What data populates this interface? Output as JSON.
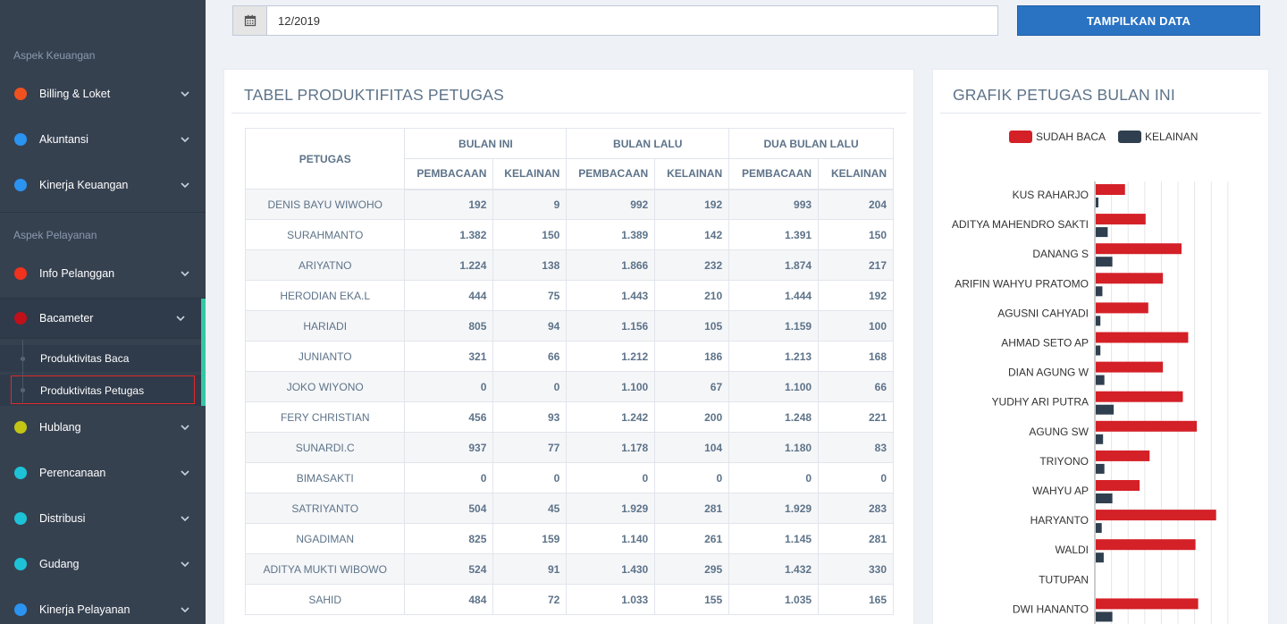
{
  "sidebar": {
    "section1": "Aspek Keuangan",
    "section2": "Aspek Pelayanan",
    "items": [
      {
        "label": "Billing & Loket",
        "color": "#f0521f"
      },
      {
        "label": "Akuntansi",
        "color": "#2b93f0"
      },
      {
        "label": "Kinerja Keuangan",
        "color": "#2b93f0"
      },
      {
        "label": "Info Pelanggan",
        "color": "#f0321f"
      },
      {
        "label": "Bacameter",
        "color": "#c0101a"
      },
      {
        "label": "Hublang",
        "color": "#c2c514"
      },
      {
        "label": "Perencanaan",
        "color": "#1ec2d6"
      },
      {
        "label": "Distribusi",
        "color": "#1ec2d6"
      },
      {
        "label": "Gudang",
        "color": "#1ec2d6"
      },
      {
        "label": "Kinerja Pelayanan",
        "color": "#2b93f0"
      }
    ],
    "subitems": [
      {
        "label": "Produktivitas Baca"
      },
      {
        "label": "Produktivitas Petugas"
      }
    ]
  },
  "filter": {
    "date_value": "12/2019",
    "button_label": "TAMPILKAN DATA"
  },
  "table_panel": {
    "title": "TABEL PRODUKTIFITAS PETUGAS",
    "col_petugas": "PETUGAS",
    "groups": [
      "BULAN INI",
      "BULAN LALU",
      "DUA BULAN LALU"
    ],
    "sub_headers": [
      "PEMBACAAN",
      "KELAINAN",
      "PEMBACAAN",
      "KELAINAN",
      "PEMBACAAN",
      "KELAINAN"
    ],
    "rows": [
      [
        "DENIS BAYU WIWOHO",
        "192",
        "9",
        "992",
        "192",
        "993",
        "204"
      ],
      [
        "SURAHMANTO",
        "1.382",
        "150",
        "1.389",
        "142",
        "1.391",
        "150"
      ],
      [
        "ARIYATNO",
        "1.224",
        "138",
        "1.866",
        "232",
        "1.874",
        "217"
      ],
      [
        "HERODIAN EKA.L",
        "444",
        "75",
        "1.443",
        "210",
        "1.444",
        "192"
      ],
      [
        "HARIADI",
        "805",
        "94",
        "1.156",
        "105",
        "1.159",
        "100"
      ],
      [
        "JUNIANTO",
        "321",
        "66",
        "1.212",
        "186",
        "1.213",
        "168"
      ],
      [
        "JOKO WIYONO",
        "0",
        "0",
        "1.100",
        "67",
        "1.100",
        "66"
      ],
      [
        "FERY CHRISTIAN",
        "456",
        "93",
        "1.242",
        "200",
        "1.248",
        "221"
      ],
      [
        "SUNARDI.C",
        "937",
        "77",
        "1.178",
        "104",
        "1.180",
        "83"
      ],
      [
        "BIMASAKTI",
        "0",
        "0",
        "0",
        "0",
        "0",
        "0"
      ],
      [
        "SATRIYANTO",
        "504",
        "45",
        "1.929",
        "281",
        "1.929",
        "283"
      ],
      [
        "NGADIMAN",
        "825",
        "159",
        "1.140",
        "261",
        "1.145",
        "281"
      ],
      [
        "ADITYA MUKTI WIBOWO",
        "524",
        "91",
        "1.430",
        "295",
        "1.432",
        "330"
      ],
      [
        "SAHID",
        "484",
        "72",
        "1.033",
        "155",
        "1.035",
        "165"
      ]
    ]
  },
  "chart_panel": {
    "title": "GRAFIK PETUGAS BULAN INI"
  },
  "chart_data": {
    "type": "bar",
    "orientation": "horizontal",
    "legend_position": "top",
    "categories": [
      "KUS RAHARJO",
      "ADITYA MAHENDRO SAKTI",
      "DANANG S",
      "ARIFIN WAHYU PRATOMO",
      "AGUSNI CAHYADI",
      "AHMAD SETO AP",
      "DIAN AGUNG W",
      "YUDHY ARI PUTRA",
      "AGUNG SW",
      "TRIYONO",
      "WAHYU AP",
      "HARYANTO",
      "WALDI",
      "TUTUPAN",
      "DWI HANANTO"
    ],
    "series": [
      {
        "name": "SUDAH BACA",
        "color": "#d42027",
        "values": [
          440,
          750,
          1290,
          1010,
          790,
          1390,
          1010,
          1310,
          1520,
          810,
          660,
          1810,
          1500,
          0,
          1540
        ]
      },
      {
        "name": "KELAINAN",
        "color": "#2f3f4f",
        "values": [
          40,
          180,
          250,
          100,
          70,
          70,
          130,
          270,
          110,
          130,
          250,
          90,
          120,
          0,
          250
        ]
      }
    ],
    "xlim": [
      0,
      2150
    ],
    "grid": true
  }
}
